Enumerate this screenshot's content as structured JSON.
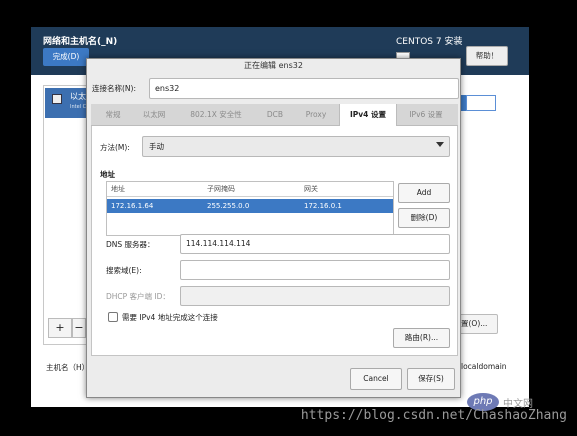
{
  "installer": {
    "title": "网络和主机名(_N)",
    "done_button": "完成(D)",
    "os_title": "CENTOS 7 安装",
    "help_button": "帮助！",
    "sidebar_item_label": "以太",
    "sidebar_item_sub": "Intel C",
    "add_button": "+",
    "remove_button": "−",
    "configure_button": "置(O)...",
    "hostname_label": "主机名（H）",
    "hostname_suffix": "localdomain"
  },
  "dialog": {
    "title": "正在编辑 ens32",
    "connection_name_label": "连接名称(N):",
    "connection_name_value": "ens32",
    "tabs": [
      "常规",
      "以太网",
      "802.1X 安全性",
      "DCB",
      "Proxy",
      "IPv4 设置",
      "IPv6 设置"
    ],
    "active_tab": "IPv4 设置",
    "method_label": "方法(M):",
    "method_value": "手动",
    "address_heading": "地址",
    "address_table": {
      "headers": [
        "地址",
        "子网掩码",
        "网关"
      ],
      "rows": [
        [
          "172.16.1.64",
          "255.255.0.0",
          "172.16.0.1"
        ]
      ]
    },
    "add_button": "Add",
    "delete_button": "删除(D)",
    "dns_label": "DNS 服务器：",
    "dns_value": "114.114.114.114",
    "search_domain_label": "搜索域(E):",
    "search_domain_value": "",
    "dhcp_client_id_label": "DHCP 客户端 ID：",
    "dhcp_client_id_value": "",
    "require_ipv4_label": "需要 IPv4 地址完成这个连接",
    "require_ipv4_checked": false,
    "routes_button": "路由(R)...",
    "cancel_button": "Cancel",
    "save_button": "保存(S)"
  },
  "watermark": {
    "url": "https://blog.csdn.net/ChashaoZhang",
    "php_logo": "php",
    "php_cn": "中文网"
  }
}
